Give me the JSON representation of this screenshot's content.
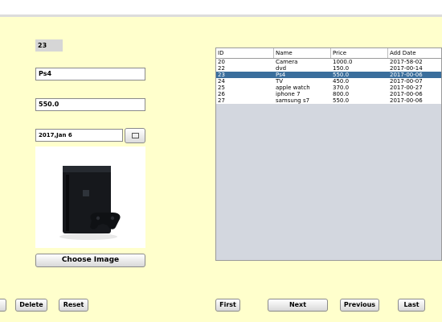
{
  "form": {
    "id_value": "23",
    "name_value": "Ps4",
    "price_value": "550.0",
    "date_value": "2017,Jan 6",
    "choose_image_label": "Choose Image"
  },
  "actions": {
    "delete_label": "Delete",
    "reset_label": "Reset"
  },
  "nav": {
    "first_label": "First",
    "next_label": "Next",
    "previous_label": "Previous",
    "last_label": "Last"
  },
  "table": {
    "columns": [
      "ID",
      "Name",
      "Price",
      "Add Date"
    ],
    "rows": [
      [
        "20",
        "Camera",
        "1000.0",
        "2017-58-02"
      ],
      [
        "22",
        "dvd",
        "150.0",
        "2017-00-14"
      ],
      [
        "23",
        "Ps4",
        "550.0",
        "2017-00-06"
      ],
      [
        "24",
        "TV",
        "450.0",
        "2017-00-07"
      ],
      [
        "25",
        "apple watch",
        "370.0",
        "2017-00-27"
      ],
      [
        "26",
        "iphone 7",
        "800.0",
        "2017-00-06"
      ],
      [
        "27",
        "samsung s7",
        "550.0",
        "2017-00-06"
      ]
    ],
    "selected_row_index": 2,
    "selection_color": "#3a6e9c"
  },
  "colors": {
    "background": "#ffffcc",
    "selection": "#3a6e9c"
  },
  "icons": {
    "date_picker": "calendar-icon",
    "product_image": "playstation-console-image"
  }
}
